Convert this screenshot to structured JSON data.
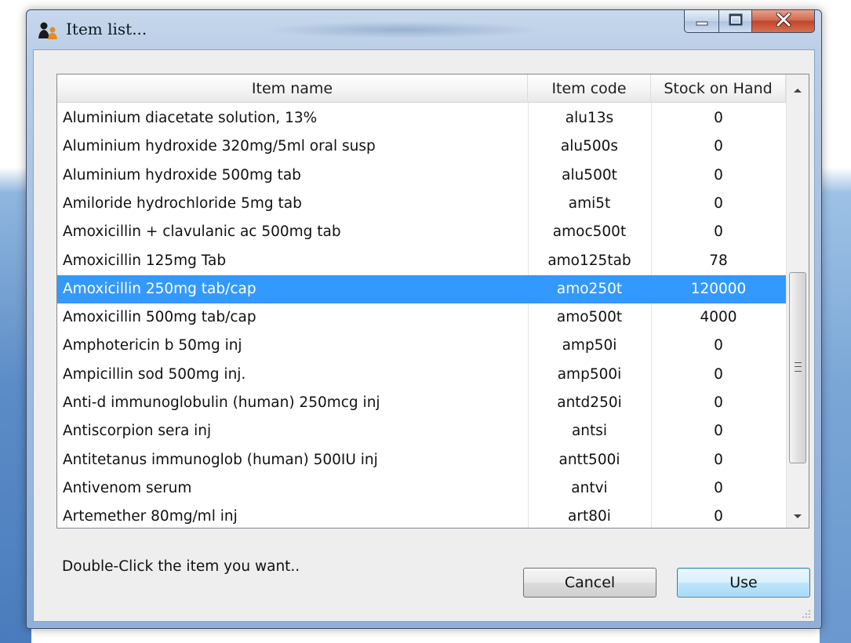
{
  "window": {
    "title": "Item list...",
    "icon": "app-people-icon",
    "caption_buttons": [
      "minimize-icon",
      "maximize-icon",
      "close-icon"
    ]
  },
  "table": {
    "columns": [
      "Item name",
      "Item code",
      "Stock on Hand"
    ],
    "rows": [
      {
        "name": "Aluminium diacetate solution, 13%",
        "code": "alu13s",
        "soh": "0"
      },
      {
        "name": "Aluminium hydroxide 320mg/5ml oral susp",
        "code": "alu500s",
        "soh": "0"
      },
      {
        "name": "Aluminium hydroxide 500mg tab",
        "code": "alu500t",
        "soh": "0"
      },
      {
        "name": "Amiloride hydrochloride 5mg tab",
        "code": "ami5t",
        "soh": "0"
      },
      {
        "name": "Amoxicillin + clavulanic ac 500mg tab",
        "code": "amoc500t",
        "soh": "0"
      },
      {
        "name": "Amoxicillin 125mg Tab",
        "code": "amo125tab",
        "soh": "78"
      },
      {
        "name": "Amoxicillin 250mg tab/cap",
        "code": "amo250t",
        "soh": "120000",
        "selected": true
      },
      {
        "name": "Amoxicillin 500mg tab/cap",
        "code": "amo500t",
        "soh": "4000"
      },
      {
        "name": "Amphotericin b 50mg inj",
        "code": "amp50i",
        "soh": "0"
      },
      {
        "name": "Ampicillin sod 500mg inj.",
        "code": "amp500i",
        "soh": "0"
      },
      {
        "name": "Anti-d immunoglobulin (human) 250mcg inj",
        "code": "antd250i",
        "soh": "0"
      },
      {
        "name": "Antiscorpion sera inj",
        "code": "antsi",
        "soh": "0"
      },
      {
        "name": "Antitetanus immunoglob (human) 500IU inj",
        "code": "antt500i",
        "soh": "0"
      },
      {
        "name": "Antivenom serum",
        "code": "antvi",
        "soh": "0"
      },
      {
        "name": "Artemether 80mg/ml inj",
        "code": "art80i",
        "soh": "0"
      }
    ],
    "scrollbar": {
      "up_icon": "scroll-up-arrow-icon",
      "down_icon": "scroll-down-arrow-icon",
      "thumb_grip_icon": "grip-lines-icon"
    }
  },
  "footer": {
    "hint": "Double-Click the item you want..",
    "cancel_label": "Cancel",
    "use_label": "Use"
  },
  "colors": {
    "selection": "#3399ff",
    "dialog_bg": "#eeeeee",
    "title_frame": "#b9cde6",
    "close_button": "#c0452b"
  }
}
